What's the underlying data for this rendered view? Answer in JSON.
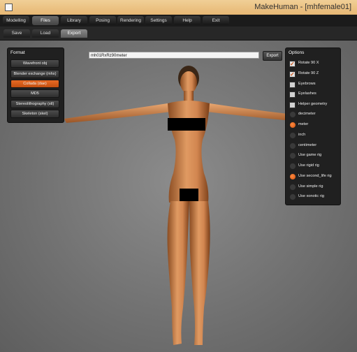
{
  "window": {
    "title": "MakeHuman - [mhfemale01]"
  },
  "menu": {
    "tabs": [
      {
        "label": "Modelling"
      },
      {
        "label": "Files"
      },
      {
        "label": "Library"
      },
      {
        "label": "Posing"
      },
      {
        "label": "Rendering"
      },
      {
        "label": "Settings"
      },
      {
        "label": "Help"
      },
      {
        "label": "Exit"
      }
    ],
    "active_tab": "Files"
  },
  "subtabs": {
    "items": [
      {
        "label": "Save"
      },
      {
        "label": "Load"
      },
      {
        "label": "Export"
      }
    ],
    "active": "Export"
  },
  "format_panel": {
    "title": "Format",
    "buttons": [
      {
        "label": "Wavefront obj"
      },
      {
        "label": "Blender exchange (mhx)"
      },
      {
        "label": "Collada (dae)"
      },
      {
        "label": "MD5"
      },
      {
        "label": "Stereolithography (stl)"
      },
      {
        "label": "Skeleton (skel)"
      }
    ],
    "selected": "Collada (dae)"
  },
  "filename": {
    "value": "mh01RxRz90meter"
  },
  "export_button": {
    "label": "Export"
  },
  "options_panel": {
    "title": "Options",
    "checkboxes": [
      {
        "label": "Rotate 90 X",
        "checked": true
      },
      {
        "label": "Rotate 90 Z",
        "checked": true
      },
      {
        "label": "Eyebrows",
        "checked": false
      },
      {
        "label": "Eyelashes",
        "checked": false
      },
      {
        "label": "Helper geometry",
        "checked": false
      }
    ],
    "units": [
      {
        "label": "decimeter",
        "selected": false
      },
      {
        "label": "meter",
        "selected": true
      },
      {
        "label": "inch",
        "selected": false
      },
      {
        "label": "centimeter",
        "selected": false
      }
    ],
    "rigs": [
      {
        "label": "Use game rig",
        "selected": false
      },
      {
        "label": "Use rigid rig",
        "selected": false
      },
      {
        "label": "Use second_life rig",
        "selected": true
      },
      {
        "label": "Use simple rig",
        "selected": false
      },
      {
        "label": "Use xonotic rig",
        "selected": false
      }
    ]
  },
  "colors": {
    "accent": "#e0601c",
    "panel": "#202020",
    "titlebar": "#e9bb7a"
  }
}
